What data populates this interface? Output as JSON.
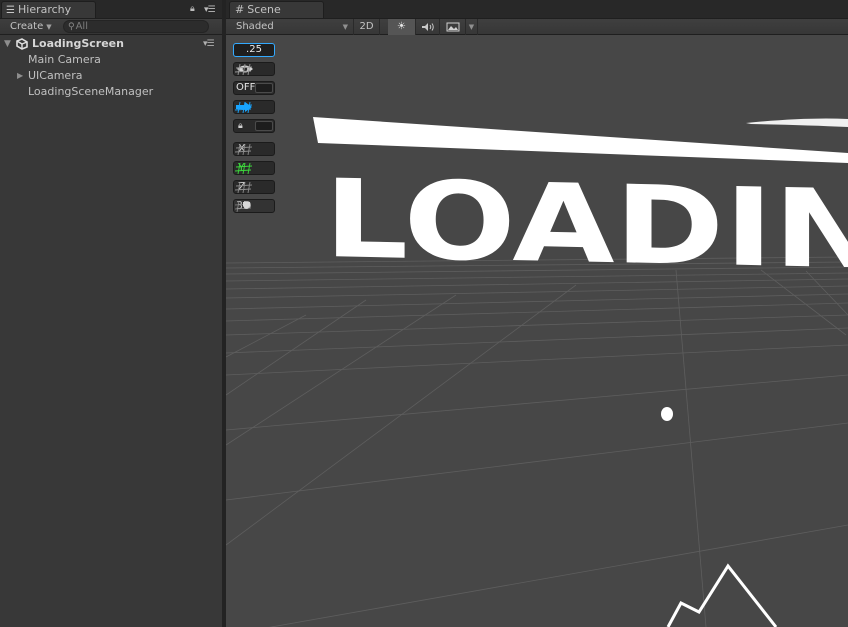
{
  "hierarchy": {
    "tab_label": "Hierarchy",
    "tab_icon": "list-icon",
    "create_label": "Create",
    "search_placeholder": "All",
    "scene_name": "LoadingScreen",
    "items": [
      {
        "label": "Main Camera",
        "expandable": false
      },
      {
        "label": "UICamera",
        "expandable": true
      },
      {
        "label": "LoadingSceneManager",
        "expandable": false
      }
    ]
  },
  "scene_view": {
    "tab_label": "Scene",
    "tab_icon": "grid-icon",
    "toolbar": {
      "draw_mode": "Shaded",
      "mode_2d_label": "2D",
      "lighting_icon": "sun-icon",
      "audio_icon": "speaker-icon",
      "effects_icon": "image-icon"
    },
    "overlay": {
      "snap_value": ".25",
      "off_label": "OFF",
      "axis_x": "X",
      "axis_y": "Y",
      "axis_z": "Z",
      "label_3d": "3D"
    },
    "content": {
      "logo_text": "LOADIN"
    },
    "colors": {
      "snap_accent": "#33aaff",
      "move_accent": "#19a5ff",
      "y_axis": "#3cd93c",
      "viewport_bg": "#474747"
    }
  }
}
